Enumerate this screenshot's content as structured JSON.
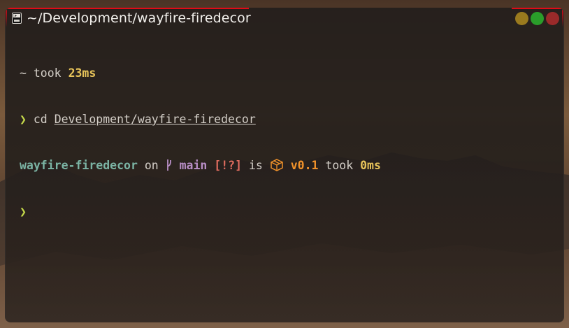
{
  "window": {
    "title": "~/Development/wayfire-firedecor",
    "accent_color": "#e00b16",
    "buttons": {
      "minimize_color": "#9a7a1e",
      "maximize_color": "#2a9d2a",
      "close_color": "#9a2a2a"
    },
    "app_icon": "terminal-app-icon"
  },
  "terminal": {
    "line1": {
      "tilde": "~",
      "took": "took",
      "duration": "23ms"
    },
    "line2": {
      "prompt": "❯",
      "command": "cd",
      "argument": "Development/wayfire-firedecor"
    },
    "line3": {
      "directory": "wayfire-firedecor",
      "on": "on",
      "git_icon": "git-branch-icon",
      "branch": "main",
      "git_status": "[!?]",
      "is": "is",
      "package_icon": "package-icon",
      "version": "v0.1",
      "took": "took",
      "duration": "0ms"
    },
    "line4": {
      "prompt": "❯"
    }
  }
}
